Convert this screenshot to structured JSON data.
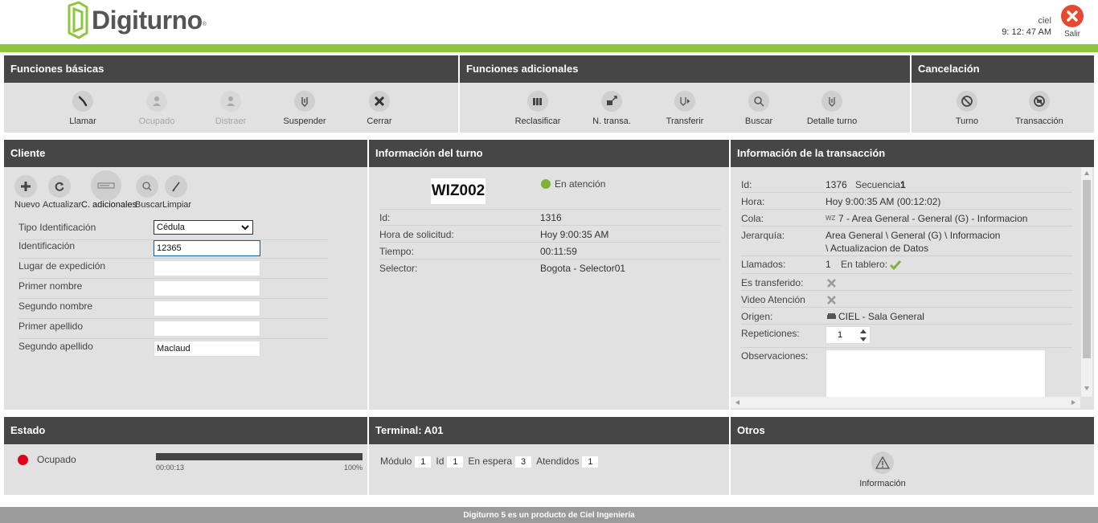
{
  "header": {
    "logo_text": "Digiturno",
    "user_name": "ciel",
    "time": "9: 12: 47 AM",
    "exit_label": "Salir"
  },
  "basic": {
    "title": "Funciones básicas",
    "items": [
      {
        "label": "Llamar",
        "icon": "microphone-icon",
        "enabled": true
      },
      {
        "label": "Ocupado",
        "icon": "busy-person-icon",
        "enabled": false
      },
      {
        "label": "Distraer",
        "icon": "person-icon",
        "enabled": false
      },
      {
        "label": "Suspender",
        "icon": "suspend-icon",
        "enabled": true
      },
      {
        "label": "Cerrar",
        "icon": "close-icon",
        "enabled": true
      }
    ]
  },
  "additional": {
    "title": "Funciones adicionales",
    "items": [
      {
        "label": "Reclasificar",
        "icon": "reclassify-icon"
      },
      {
        "label": "N. transa.",
        "icon": "new-transaction-icon"
      },
      {
        "label": "Transferir",
        "icon": "transfer-icon"
      },
      {
        "label": "Buscar",
        "icon": "search-icon"
      },
      {
        "label": "Detalle turno",
        "icon": "detail-icon"
      }
    ]
  },
  "cancel": {
    "title": "Cancelación",
    "items": [
      {
        "label": "Turno",
        "icon": "cancel-ticket-icon"
      },
      {
        "label": "Transacción",
        "icon": "cancel-transaction-icon"
      }
    ]
  },
  "client": {
    "title": "Cliente",
    "tools": [
      {
        "label": "Nuevo",
        "icon": "plus-icon"
      },
      {
        "label": "Actualizar",
        "icon": "refresh-icon"
      },
      {
        "label": "C. adicionales",
        "icon": "card-icon"
      },
      {
        "label": "Buscar",
        "icon": "search-icon"
      },
      {
        "label": "Limpiar",
        "icon": "broom-icon"
      }
    ],
    "fields": [
      {
        "label": "Tipo Identificación",
        "value": "Cédula",
        "type": "select"
      },
      {
        "label": "Identificación",
        "value": "12365",
        "type": "input"
      },
      {
        "label": "Lugar de expedición",
        "value": "",
        "type": "input"
      },
      {
        "label": "Primer nombre",
        "value": "",
        "type": "input"
      },
      {
        "label": "Segundo nombre",
        "value": "",
        "type": "input"
      },
      {
        "label": "Primer apellido",
        "value": "",
        "type": "input"
      },
      {
        "label": "Segundo apellido",
        "value": "Maclaud",
        "type": "input"
      }
    ]
  },
  "turn": {
    "title": "Información del turno",
    "code": "WIZ002",
    "status": "En atención",
    "status_color": "#7fb23a",
    "rows": [
      {
        "label": "Id:",
        "value": "1316"
      },
      {
        "label": "Hora de solicitud:",
        "value": "Hoy 9:00:35 AM"
      },
      {
        "label": "Tiempo:",
        "value": "00:11:59"
      },
      {
        "label": "Selector:",
        "value": "Bogota - Selector01"
      }
    ]
  },
  "transaction": {
    "title": "Información de la transacción",
    "id_label": "Id:",
    "id_value": "1376",
    "seq_label": "Secuencia:",
    "seq_value": "1",
    "hora_label": "Hora:",
    "hora_value": "Hoy 9:00:35 AM (00:12:02)",
    "cola_label": "Cola:",
    "cola_prefix": "WZ",
    "cola_value": "7 - Area General - General (G) - Informacion",
    "jer_label": "Jerarquía:",
    "jer_line1": "Area General \\ General (G) \\ Informacion",
    "jer_line2": "\\ Actualizacion de Datos",
    "llamados_label": "Llamados:",
    "llamados_value": "1",
    "tablero_label": "En tablero:",
    "transferido_label": "Es transferido:",
    "video_label": "Video Atención",
    "origen_label": "Origen:",
    "origen_value": "CIEL - Sala General",
    "rep_label": "Repeticiones:",
    "rep_value": "1",
    "obs_label": "Observaciones:"
  },
  "estado": {
    "title": "Estado",
    "status": "Ocupado",
    "status_color": "#e3001b",
    "progress_start": "00:00:13",
    "progress_end": "100%",
    "progress_fraction": 1.0
  },
  "terminal": {
    "title": "Terminal: A01",
    "modulo_label": "Módulo",
    "modulo_value": "1",
    "id_label": "Id",
    "id_value": "1",
    "espera_label": "En espera",
    "espera_value": "3",
    "atendidos_label": "Atendidos",
    "atendidos_value": "1"
  },
  "otros": {
    "title": "Otros",
    "info_label": "Información"
  },
  "footer": {
    "text": "Digiturno 5 es un producto de Ciel Ingeniería"
  },
  "colors": {
    "brand_green": "#8dc63f",
    "header_dark": "#464646",
    "panel_bg": "#e1e1e1",
    "exit_red": "#e8482f"
  }
}
